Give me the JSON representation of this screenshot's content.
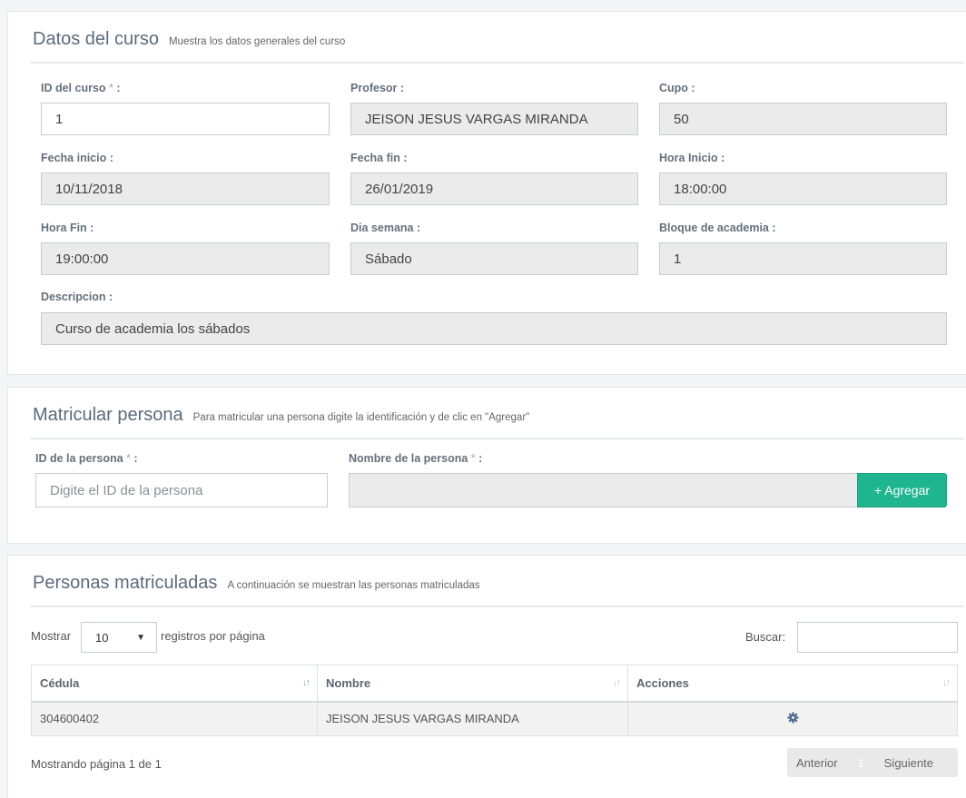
{
  "curso": {
    "title": "Datos del curso",
    "subtitle": "Muestra los datos generales del curso",
    "fields": {
      "id": {
        "label": "ID del curso",
        "req": "*",
        "colon": " :",
        "value": "1"
      },
      "profesor": {
        "label": "Profesor :",
        "value": "JEISON JESUS VARGAS MIRANDA"
      },
      "cupo": {
        "label": "Cupo :",
        "value": "50"
      },
      "fecha_inicio": {
        "label": "Fecha inicio :",
        "value": "10/11/2018"
      },
      "fecha_fin": {
        "label": "Fecha fin :",
        "value": "26/01/2019"
      },
      "hora_inicio": {
        "label": "Hora Inicio :",
        "value": "18:00:00"
      },
      "hora_fin": {
        "label": "Hora Fin :",
        "value": "19:00:00"
      },
      "dia_semana": {
        "label": "Dia semana :",
        "value": "Sábado"
      },
      "bloque": {
        "label": "Bloque de academia :",
        "value": "1"
      },
      "descripcion": {
        "label": "Descripcion :",
        "value": "Curso de academia los sábados"
      }
    }
  },
  "matricular": {
    "title": "Matricular persona",
    "subtitle": "Para matricular una persona digite la identificación y de clic en \"Agregar\"",
    "id_label": "ID de la persona",
    "id_placeholder": "Digite el ID de la persona",
    "nombre_label": "Nombre de la persona",
    "req": "*",
    "colon": " :",
    "nombre_value": "",
    "agregar_label": "+ Agregar"
  },
  "matriculadas": {
    "title": "Personas matriculadas",
    "subtitle": "A continuación se muestran las personas matriculadas",
    "mostrar_label": "Mostrar",
    "page_size": "10",
    "registros_label": "registros por página",
    "buscar_label": "Buscar:",
    "buscar_value": "",
    "columns": [
      "Cédula",
      "Nombre",
      "Acciones"
    ],
    "rows": [
      {
        "cedula": "304600402",
        "nombre": "JEISON JESUS VARGAS MIRANDA",
        "accion_icon": "gear-icon"
      }
    ],
    "info": "Mostrando página 1 de 1",
    "pager": {
      "prev": "Anterior",
      "page": "1",
      "next": "Siguiente"
    }
  },
  "colors": {
    "accent_button": "#1fb58f",
    "action_icon": "#4a6a8a"
  }
}
